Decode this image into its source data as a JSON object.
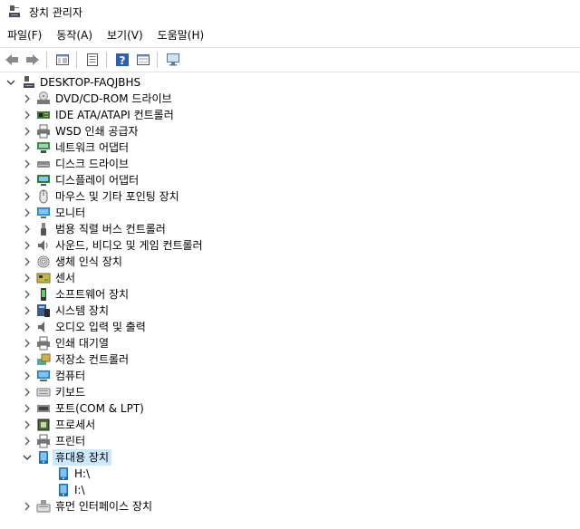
{
  "window": {
    "title": "장치 관리자"
  },
  "menu": [
    "파일(F)",
    "동작(A)",
    "보기(V)",
    "도움말(H)"
  ],
  "toolbar": {
    "buttons": [
      "back-icon",
      "forward-icon",
      "properties-pane-icon",
      "properties-icon",
      "help-icon",
      "view-icon",
      "monitor-scan-icon"
    ]
  },
  "tree": {
    "root": "DESKTOP-FAQJBHS",
    "categories": [
      {
        "label": "DVD/CD-ROM 드라이브",
        "icon": "dvd-icon"
      },
      {
        "label": "IDE ATA/ATAPI 컨트롤러",
        "icon": "ide-controller-icon"
      },
      {
        "label": "WSD 인쇄 공급자",
        "icon": "printer-icon"
      },
      {
        "label": "네트워크 어댑터",
        "icon": "network-adapter-icon"
      },
      {
        "label": "디스크 드라이브",
        "icon": "disk-drive-icon"
      },
      {
        "label": "디스플레이 어댑터",
        "icon": "display-adapter-icon"
      },
      {
        "label": "마우스 및 기타 포인팅 장치",
        "icon": "mouse-icon"
      },
      {
        "label": "모니터",
        "icon": "monitor-icon"
      },
      {
        "label": "범용 직렬 버스 컨트롤러",
        "icon": "usb-icon"
      },
      {
        "label": "사운드, 비디오 및 게임 컨트롤러",
        "icon": "speaker-icon"
      },
      {
        "label": "생체 인식 장치",
        "icon": "fingerprint-icon"
      },
      {
        "label": "센서",
        "icon": "sensor-icon"
      },
      {
        "label": "소프트웨어 장치",
        "icon": "software-device-icon"
      },
      {
        "label": "시스템 장치",
        "icon": "system-device-icon"
      },
      {
        "label": "오디오 입력 및 출력",
        "icon": "audio-io-icon"
      },
      {
        "label": "인쇄 대기열",
        "icon": "print-queue-icon"
      },
      {
        "label": "저장소 컨트롤러",
        "icon": "storage-controller-icon"
      },
      {
        "label": "컴퓨터",
        "icon": "computer-icon"
      },
      {
        "label": "키보드",
        "icon": "keyboard-icon"
      },
      {
        "label": "포트(COM & LPT)",
        "icon": "port-icon"
      },
      {
        "label": "프로세서",
        "icon": "processor-icon"
      },
      {
        "label": "프린터",
        "icon": "printer-icon"
      },
      {
        "label": "휴대용 장치",
        "icon": "portable-device-icon",
        "expanded": true,
        "selected": true,
        "children": [
          {
            "label": "H:\\",
            "icon": "portable-device-icon"
          },
          {
            "label": "I:\\",
            "icon": "portable-device-icon"
          }
        ]
      },
      {
        "label": "휴먼 인터페이스 장치",
        "icon": "hid-icon"
      }
    ]
  },
  "colors": {
    "selection": "#cce8ff",
    "accent": "#1a79c8"
  }
}
